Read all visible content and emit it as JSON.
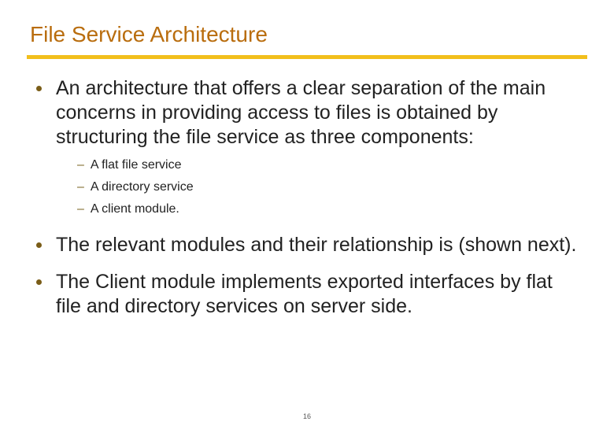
{
  "title": "File Service Architecture",
  "bullets": [
    {
      "text": "An architecture that offers a clear separation of the main concerns in providing access to files is obtained by structuring the file service as three components:",
      "sub": [
        "A flat file service",
        "A directory service",
        "A client module."
      ]
    },
    {
      "text": "The relevant modules and their relationship is (shown next).",
      "sub": []
    },
    {
      "text": "The Client module implements exported interfaces by flat file and directory services on server side.",
      "sub": []
    }
  ],
  "page_number": "16"
}
